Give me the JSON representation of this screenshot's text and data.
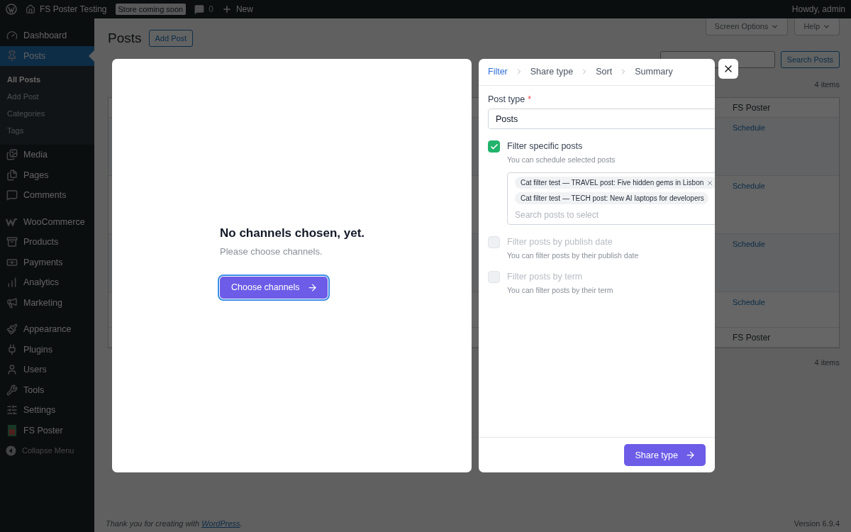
{
  "admin_bar": {
    "site_name": "FS Poster Testing",
    "store_badge": "Store coming soon",
    "comments_count": "0",
    "new_label": "New",
    "greeting": "Howdy, admin"
  },
  "sidebar": {
    "groups": [
      [
        {
          "label": "Dashboard",
          "selected": false
        },
        {
          "label": "Posts",
          "selected": true,
          "children": [
            {
              "label": "All Posts",
              "selected": true
            },
            {
              "label": "Add Post",
              "selected": false
            },
            {
              "label": "Categories",
              "selected": false
            },
            {
              "label": "Tags",
              "selected": false
            }
          ]
        },
        {
          "label": "Media",
          "selected": false
        },
        {
          "label": "Pages",
          "selected": false
        },
        {
          "label": "Comments",
          "selected": false
        }
      ],
      [
        {
          "label": "WooCommerce",
          "selected": false
        },
        {
          "label": "Products",
          "selected": false
        },
        {
          "label": "Payments",
          "selected": false
        },
        {
          "label": "Analytics",
          "selected": false
        },
        {
          "label": "Marketing",
          "selected": false
        }
      ],
      [
        {
          "label": "Appearance",
          "selected": false
        },
        {
          "label": "Plugins",
          "selected": false
        },
        {
          "label": "Users",
          "selected": false
        },
        {
          "label": "Tools",
          "selected": false
        },
        {
          "label": "Settings",
          "selected": false
        },
        {
          "label": "FS Poster",
          "selected": false
        }
      ]
    ],
    "collapse_label": "Collapse Menu"
  },
  "page": {
    "title": "Posts",
    "add_button": "Add Post",
    "screen_options": "Screen Options",
    "help": "Help",
    "search_button": "Search Posts",
    "items_count_top": "4 items",
    "table": {
      "column": "FS Poster",
      "rows": [
        {
          "action": "Schedule"
        },
        {
          "action": "Schedule"
        },
        {
          "action": "Schedule"
        },
        {
          "action": "Schedule"
        }
      ],
      "footer_column": "FS Poster"
    },
    "items_count_bottom": "4 items"
  },
  "footer": {
    "thanks_prefix": "Thank you for creating with ",
    "link": "WordPress",
    "thanks_suffix": ".",
    "version": "Version 6.9.4"
  },
  "channels_modal": {
    "title": "No channels chosen, yet.",
    "message": "Please choose channels.",
    "button": "Choose channels"
  },
  "filter_panel": {
    "steps": [
      {
        "label": "Filter",
        "selected": true
      },
      {
        "label": "Share type",
        "selected": false
      },
      {
        "label": "Sort",
        "selected": false
      },
      {
        "label": "Summary",
        "selected": false
      }
    ],
    "post_type": {
      "label": "Post type",
      "required_mark": "*",
      "value": "Posts"
    },
    "options": [
      {
        "label": "Filter specific posts",
        "description": "You can schedule selected posts",
        "checked": true,
        "disabled": false,
        "chips": [
          "Cat filter test — TRAVEL post: Five hidden gems in Lisbon",
          "Cat filter test — TECH post: New AI laptops for developers"
        ],
        "placeholder": "Search posts to select"
      },
      {
        "label": "Filter posts by publish date",
        "description": "You can filter posts by their publish date",
        "checked": false,
        "disabled": true
      },
      {
        "label": "Filter posts by term",
        "description": "You can filter posts by their term",
        "checked": false,
        "disabled": true
      }
    ],
    "next_button": "Share type"
  }
}
